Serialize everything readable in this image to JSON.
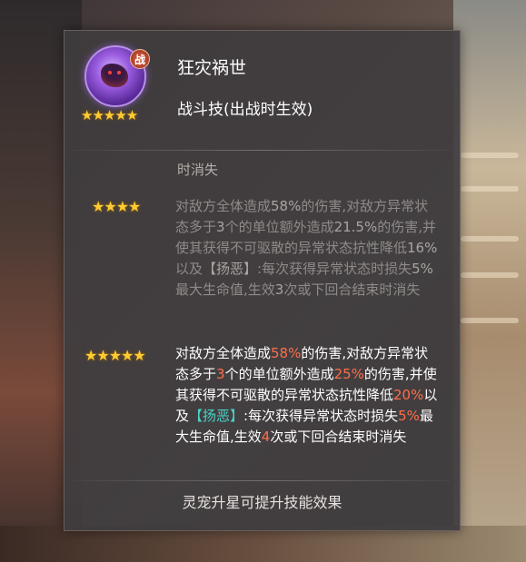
{
  "skill": {
    "name": "狂灾祸世",
    "type": "战斗技(出战时生效)",
    "class_badge": "战",
    "icon": "pet-skill-avatar-icon"
  },
  "fragment_text": "时消失",
  "tiers": [
    {
      "stars": "★★★★",
      "active": false,
      "segments": [
        {
          "t": "对敌方全体造成"
        },
        {
          "t": "58%",
          "hl": true
        },
        {
          "t": "的伤害,对敌方异常状态多于"
        },
        {
          "t": "3",
          "hl": true
        },
        {
          "t": "个的单位额外造成"
        },
        {
          "t": "21.5%",
          "hl": true
        },
        {
          "t": "的伤害,并使其获得不可驱散的异常状态抗性降低"
        },
        {
          "t": "16%",
          "hl": true
        },
        {
          "t": "以及"
        },
        {
          "t": "【扬恶】",
          "bk": true
        },
        {
          "t": ":每次获得异常状态时损失"
        },
        {
          "t": "5%",
          "hl": true
        },
        {
          "t": "最大生命值,生效"
        },
        {
          "t": "3",
          "hl": true
        },
        {
          "t": "次或下回合结束时消失"
        }
      ]
    },
    {
      "stars": "★★★★★",
      "active": true,
      "segments": [
        {
          "t": "对敌方全体造成"
        },
        {
          "t": "58%",
          "hl": true
        },
        {
          "t": "的伤害,对敌方异常状态多于"
        },
        {
          "t": "3",
          "hl": true
        },
        {
          "t": "个的单位额外造成"
        },
        {
          "t": "25%",
          "hl": true
        },
        {
          "t": "的伤害,并使其获得不可驱散的异常状态抗性降低"
        },
        {
          "t": "20%",
          "hl": true
        },
        {
          "t": "以及"
        },
        {
          "t": "【扬恶】",
          "bk": true
        },
        {
          "t": ":每次获得异常状态时损失"
        },
        {
          "t": "5%",
          "hl": true
        },
        {
          "t": "最大生命值,生效"
        },
        {
          "t": "4",
          "hl": true
        },
        {
          "t": "次或下回合结束时消失"
        }
      ]
    }
  ],
  "footer": "灵宠升星可提升技能效果",
  "avatar_stars": "★★★★★",
  "colors": {
    "highlight": "#ff6e4a",
    "bracket": "#4ad2c8",
    "star": "#ffcc33",
    "panel_bg": "#403c3e"
  }
}
